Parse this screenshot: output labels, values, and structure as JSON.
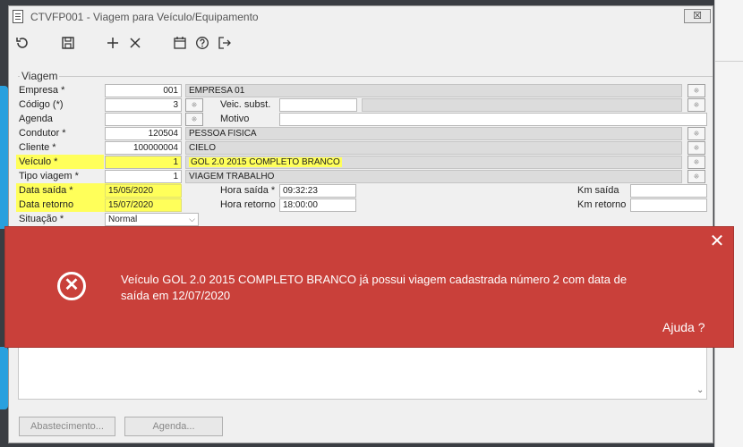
{
  "window": {
    "title": "CTVFP001 - Viagem para Veículo/Equipamento",
    "close_symbol": "☒"
  },
  "toolbar": {
    "icons": [
      "refresh-icon",
      "save-icon",
      "add-icon",
      "delete-icon",
      "calendar-icon",
      "help-icon",
      "exit-icon"
    ]
  },
  "form": {
    "legend": "Viagem",
    "empresa": {
      "label": "Empresa *",
      "code": "001",
      "name": "EMPRESA 01"
    },
    "codigo": {
      "label": "Código (*)",
      "value": "3"
    },
    "veic_subst": {
      "label": "Veic. subst.",
      "value": "",
      "desc": ""
    },
    "agenda": {
      "label": "Agenda",
      "value": ""
    },
    "motivo": {
      "label": "Motivo",
      "value": ""
    },
    "condutor": {
      "label": "Condutor *",
      "code": "120504",
      "name": "PESSOA FISICA"
    },
    "cliente": {
      "label": "Cliente *",
      "code": "100000004",
      "name": "CIELO"
    },
    "veiculo": {
      "label": "Veículo *",
      "code": "1",
      "name": "GOL 2.0 2015 COMPLETO BRANCO"
    },
    "tipo_viagem": {
      "label": "Tipo viagem *",
      "code": "1",
      "name": "VIAGEM TRABALHO"
    },
    "data_saida": {
      "label": "Data saída *",
      "value": "15/05/2020"
    },
    "hora_saida": {
      "label": "Hora saída *",
      "value": "09:32:23"
    },
    "km_saida": {
      "label": "Km saída",
      "value": ""
    },
    "data_retorno": {
      "label": "Data retorno",
      "value": "15/07/2020"
    },
    "hora_retorno": {
      "label": "Hora retorno",
      "value": "18:00:00"
    },
    "km_retorno": {
      "label": "Km retorno",
      "value": ""
    },
    "situacao": {
      "label": "Situação *",
      "value": "Normal"
    }
  },
  "buttons": {
    "abastecimento": "Abastecimento...",
    "agenda": "Agenda..."
  },
  "toast": {
    "message": "Veículo GOL 2.0 2015 COMPLETO BRANCO já possui viagem cadastrada número 2 com data de saída em 12/07/2020",
    "help": "Ajuda ?",
    "close": "✕",
    "icon_symbol": "✕"
  },
  "colors": {
    "highlight": "#ffff5a",
    "toast_bg": "#c9403a",
    "accent": "#29a0de"
  }
}
